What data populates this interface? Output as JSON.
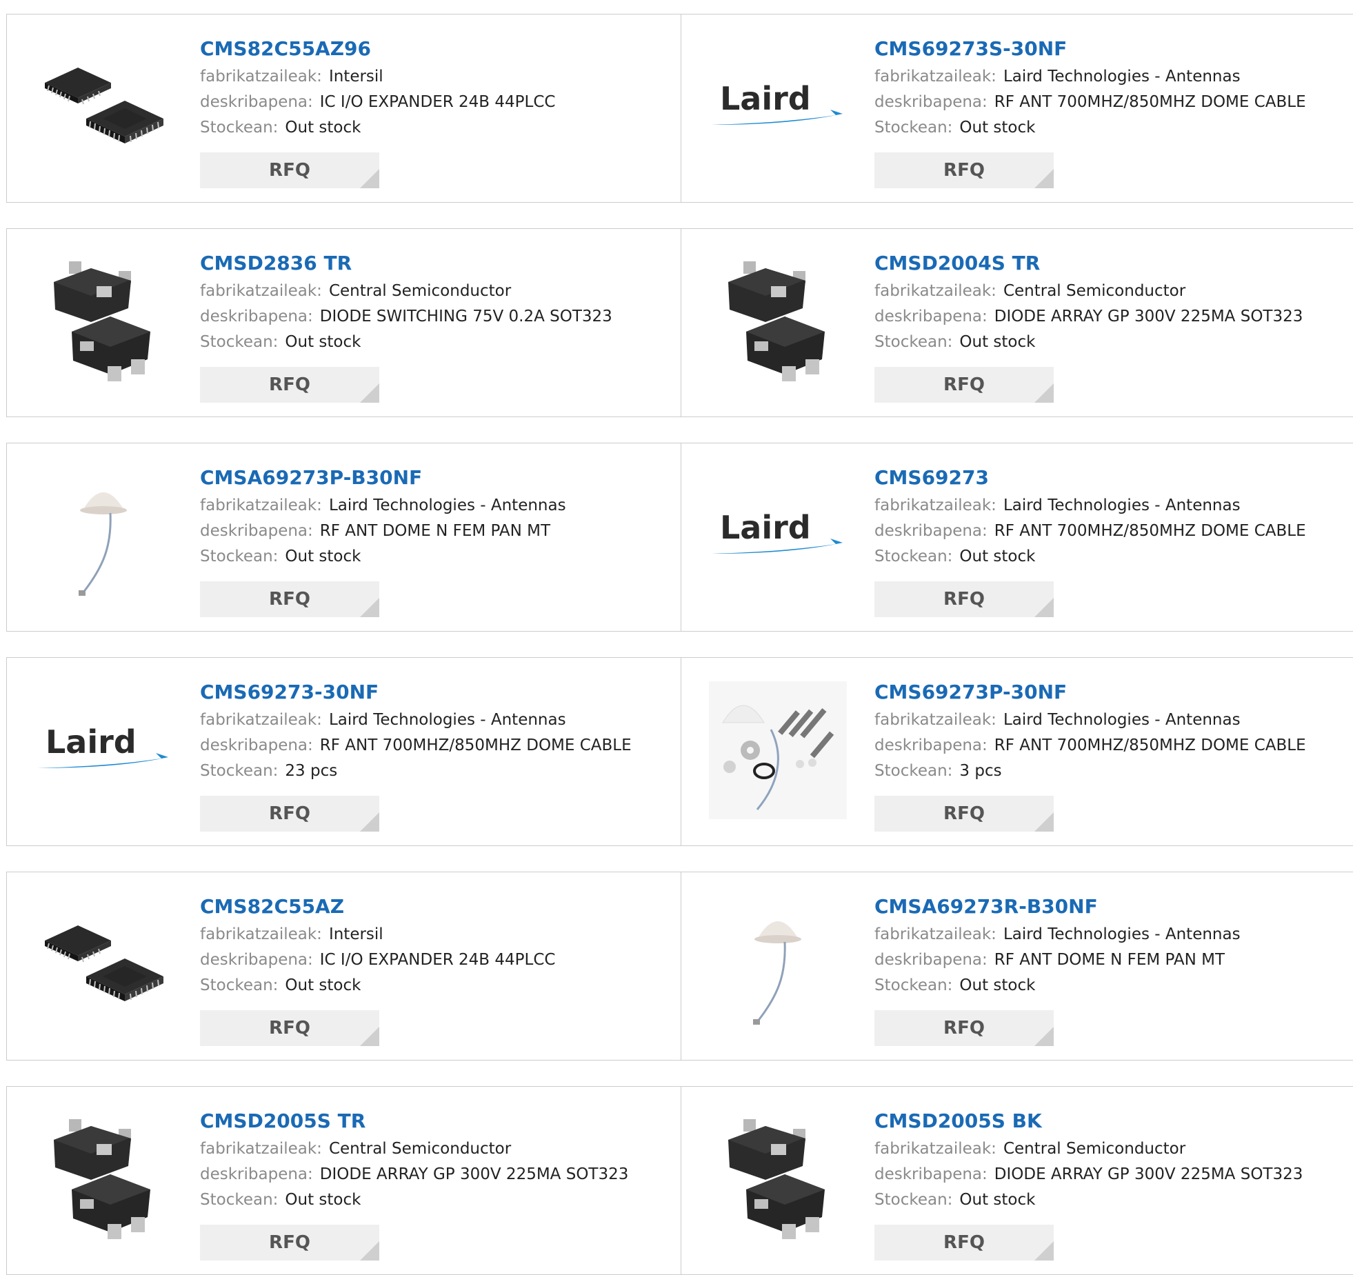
{
  "labels": {
    "manufacturer": "fabrikatzaileak:",
    "description": "deskribapena:",
    "stock": "Stockean:",
    "rfq": "RFQ"
  },
  "colors": {
    "part_link": "#1a6ab5",
    "label": "#8a8a8a",
    "rfq_bg": "#efefef",
    "border": "#cccccc"
  },
  "products": [
    {
      "part": "CMS82C55AZ96",
      "manufacturer": "Intersil",
      "description": "IC I/O EXPANDER 24B 44PLCC",
      "stock": "Out stock",
      "image": "plcc-chip-image"
    },
    {
      "part": "CMS69273S-30NF",
      "manufacturer": "Laird Technologies - Antennas",
      "description": "RF ANT 700MHZ/850MHZ DOME CABLE",
      "stock": "Out stock",
      "image": "laird-logo",
      "logo_text": "Laird"
    },
    {
      "part": "CMSD2836 TR",
      "manufacturer": "Central Semiconductor",
      "description": "DIODE SWITCHING 75V 0.2A SOT323",
      "stock": "Out stock",
      "image": "sot323-image"
    },
    {
      "part": "CMSD2004S TR",
      "manufacturer": "Central Semiconductor",
      "description": "DIODE ARRAY GP 300V 225MA SOT323",
      "stock": "Out stock",
      "image": "sot323-image"
    },
    {
      "part": "CMSA69273P-B30NF",
      "manufacturer": "Laird Technologies - Antennas",
      "description": "RF ANT DOME N FEM PAN MT",
      "stock": "Out stock",
      "image": "dome-antenna-image"
    },
    {
      "part": "CMS69273",
      "manufacturer": "Laird Technologies - Antennas",
      "description": "RF ANT 700MHZ/850MHZ DOME CABLE",
      "stock": "Out stock",
      "image": "laird-logo",
      "logo_text": "Laird"
    },
    {
      "part": "CMS69273-30NF",
      "manufacturer": "Laird Technologies - Antennas",
      "description": "RF ANT 700MHZ/850MHZ DOME CABLE",
      "stock": "23 pcs",
      "image": "laird-logo",
      "logo_text": "Laird"
    },
    {
      "part": "CMS69273P-30NF",
      "manufacturer": "Laird Technologies - Antennas",
      "description": "RF ANT 700MHZ/850MHZ DOME CABLE",
      "stock": "3 pcs",
      "image": "antenna-kit-image"
    },
    {
      "part": "CMS82C55AZ",
      "manufacturer": "Intersil",
      "description": "IC I/O EXPANDER 24B 44PLCC",
      "stock": "Out stock",
      "image": "plcc-chip-image"
    },
    {
      "part": "CMSA69273R-B30NF",
      "manufacturer": "Laird Technologies - Antennas",
      "description": "RF ANT DOME N FEM PAN MT",
      "stock": "Out stock",
      "image": "dome-antenna-image"
    },
    {
      "part": "CMSD2005S TR",
      "manufacturer": "Central Semiconductor",
      "description": "DIODE ARRAY GP 300V 225MA SOT323",
      "stock": "Out stock",
      "image": "sot323-image"
    },
    {
      "part": "CMSD2005S BK",
      "manufacturer": "Central Semiconductor",
      "description": "DIODE ARRAY GP 300V 225MA SOT323",
      "stock": "Out stock",
      "image": "sot323-image"
    }
  ]
}
